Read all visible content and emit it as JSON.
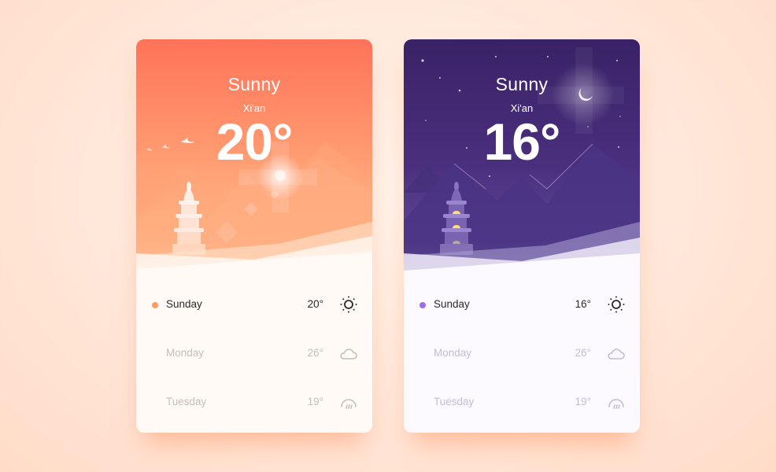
{
  "cards": [
    {
      "theme": "day",
      "condition": "Sunny",
      "city": "Xi'an",
      "temperature": "20°",
      "accent": "#ff9a63",
      "forecast": [
        {
          "day": "Sunday",
          "temp": "20°",
          "icon": "sun-icon",
          "active": true
        },
        {
          "day": "Monday",
          "temp": "26°",
          "icon": "cloud-icon",
          "active": false
        },
        {
          "day": "Tuesday",
          "temp": "19°",
          "icon": "rain-icon",
          "active": false
        }
      ]
    },
    {
      "theme": "night",
      "condition": "Sunny",
      "city": "Xi'an",
      "temperature": "16°",
      "accent": "#9b6fe8",
      "forecast": [
        {
          "day": "Sunday",
          "temp": "16°",
          "icon": "sun-icon",
          "active": true
        },
        {
          "day": "Monday",
          "temp": "26°",
          "icon": "cloud-icon",
          "active": false
        },
        {
          "day": "Tuesday",
          "temp": "19°",
          "icon": "rain-icon",
          "active": false
        }
      ]
    }
  ]
}
